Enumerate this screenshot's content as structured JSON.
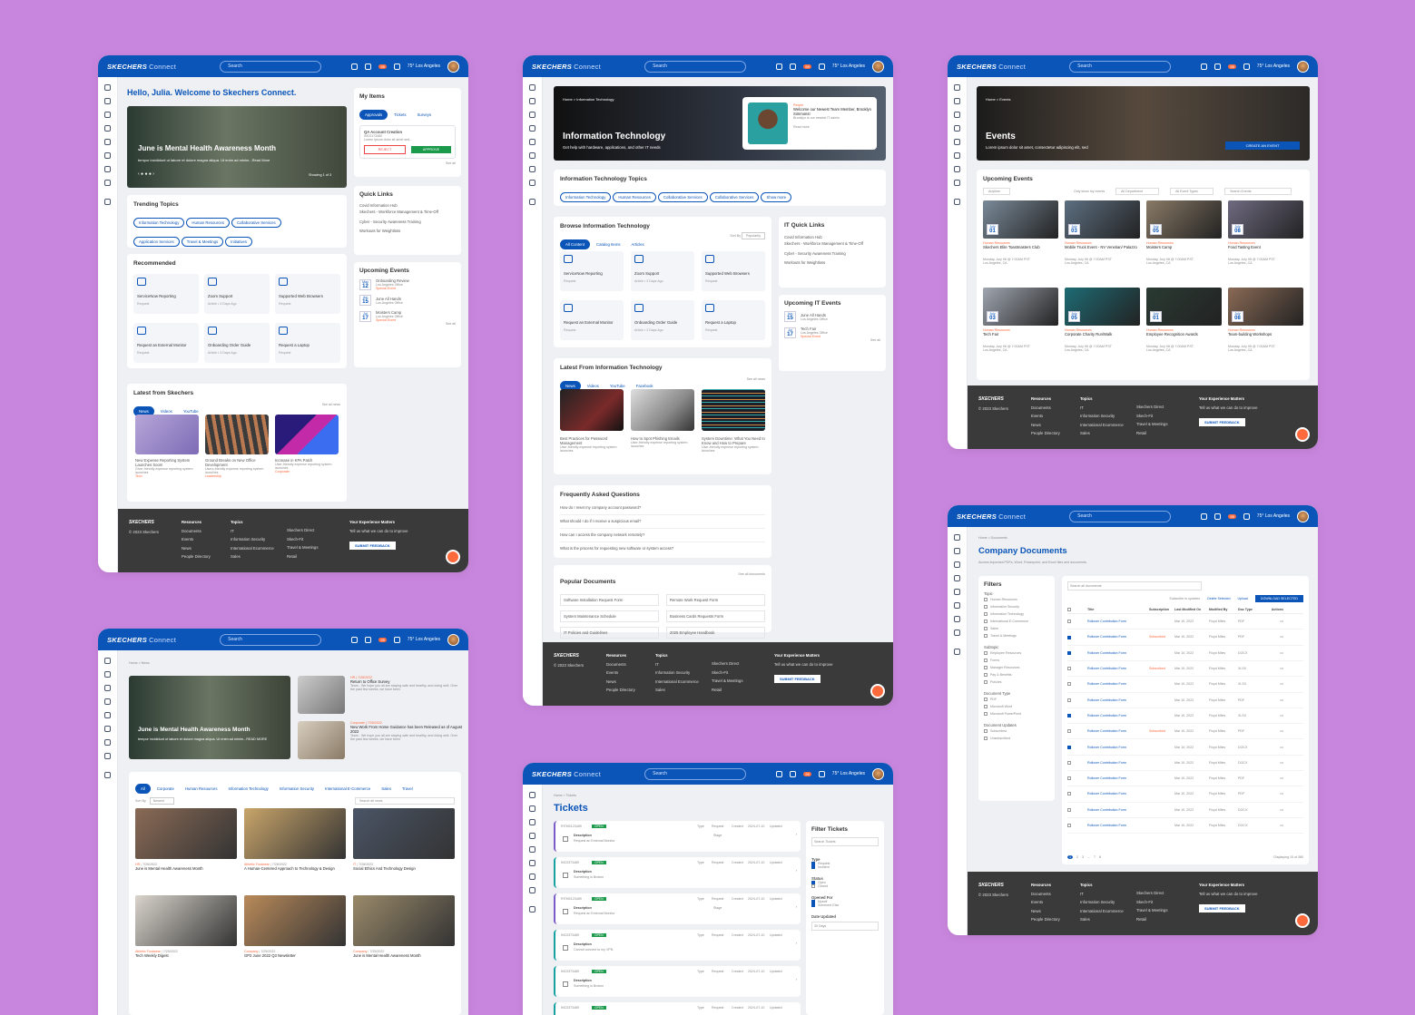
{
  "common": {
    "logo": "SKECHERS",
    "logo_sub": "Connect",
    "search": "Search",
    "weather": "75° Los Angeles",
    "badge": "99"
  },
  "home": {
    "greeting_a": "Hello, Julia.",
    "greeting_b": "Welcome to Skechers Connect.",
    "hero_title": "June is Mental Health Awareness Month",
    "hero_sub": "tempor incididunt ut labore et dolore magna aliqua. Ut enim ad minim...Read More",
    "hero_count": "Showing 1 of 3",
    "my_items": "My Items",
    "tabs": [
      "Approvals",
      "Tickets",
      "Surveys"
    ],
    "item_title": "QA Account Creation",
    "item_status": "NEW",
    "item_id": "INC0173480",
    "item_desc": "Lorem ipsum dolor sit amet sed...",
    "reject": "REJECT",
    "approve": "APPROVE",
    "see_all": "See all",
    "trending": "Trending Topics",
    "topics": [
      "Information Technology",
      "Human Resources",
      "Collaborative Services",
      "Application Services",
      "Travel & Meetings",
      "Initiatives"
    ],
    "quick_links": "Quick Links",
    "links": [
      "Covid Information Hub",
      "Skechers - Workforce Management & Time-Off",
      "Cyber - Security Awareness Training",
      "Workouts for Weightloss"
    ],
    "recommended": "Recommended",
    "rec": [
      {
        "t": "ServiceNow Reporting",
        "s": "Request"
      },
      {
        "t": "Zoom Support",
        "s": "Article • 3 Days Ago"
      },
      {
        "t": "Supported Web Browsers",
        "s": "Request"
      },
      {
        "t": "Request an External Monitor",
        "s": "Request"
      },
      {
        "t": "Onboarding Order Guide",
        "s": "Article • 3 Days Ago"
      },
      {
        "t": "Request a Laptop",
        "s": "Request"
      }
    ],
    "upcoming": "Upcoming Events",
    "events": [
      {
        "m": "May",
        "d": "12",
        "t": "Onboarding Review",
        "l": "Los Angeles Office",
        "x": "Special Event"
      },
      {
        "m": "Jun",
        "d": "15",
        "t": "June All Hands",
        "l": "Los Angeles Office",
        "x": ""
      },
      {
        "m": "Jul",
        "d": "17",
        "t": "Moisters Camp",
        "l": "Los Angeles Office",
        "x": "Special Event"
      }
    ],
    "latest": "Latest from Skechers",
    "latest_tabs": [
      "News",
      "Videos",
      "YouTube"
    ],
    "see_all_news": "See all news",
    "news": [
      {
        "t": "New Expense Reporting System Launches Soon!",
        "d": "Giver-friendly expense reporting system launches",
        "tag": "Tech"
      },
      {
        "t": "Ground Breaks on New Office Development",
        "d": "Users-friendly expense reporting system launches",
        "tag": "Leadership"
      },
      {
        "t": "Increase in KPA Patch",
        "d": "User-friendly expense reporting system launches",
        "tag": "Corporate"
      }
    ]
  },
  "footer": {
    "copy": "© 2023 Skechers",
    "resources": "Resources",
    "res": [
      "Documents",
      "Events",
      "News",
      "People Directory"
    ],
    "topics": "Topics",
    "top": [
      "IT",
      "Information Security",
      "International Ecommerce",
      "Sales"
    ],
    "more": [
      "Skechers Direct",
      "Skech-Fit",
      "Travel & Meetings",
      "Retail"
    ],
    "matters": "Your Experience Matters",
    "matters_sub": "Tell us what we can do to improve",
    "submit": "SUBMIT FEEDBACK"
  },
  "it": {
    "crumb": "Home  >  Information Technology",
    "title": "Information Technology",
    "sub": "Get help with hardware, applications, and other IT needs",
    "card_tag": "People",
    "card_title": "Welcome our Newest Team Member, Brooklyn Simmons!",
    "card_sub": "Brooklyn is our newest IT admin",
    "card_more": "Read more",
    "topics_h": "Information Technology Topics",
    "topics": [
      "Information Technology",
      "Human Resources",
      "Collaborative Services",
      "Collaborative Services",
      "Show more"
    ],
    "browse": "Browse Information Technology",
    "browse_tabs": [
      "All Content",
      "Catalog Items",
      "Articles"
    ],
    "sort": "Sort By",
    "sort_val": "Popularity",
    "quick": "IT Quick Links",
    "upcoming": "Upcoming IT Events",
    "ev": [
      {
        "m": "Jun",
        "d": "15",
        "t": "June All Hands",
        "l": "Los Angeles Office"
      },
      {
        "m": "Jul",
        "d": "17",
        "t": "Tech Fair",
        "l": "Los Angeles Office",
        "x": "Special Event"
      }
    ],
    "latest": "Latest From Information Technology",
    "latest_tabs": [
      "News",
      "Videos",
      "YouTube",
      "Facebook"
    ],
    "news": [
      {
        "t": "Best Practices for Password Management",
        "d": "User-friendly expense reporting system launches"
      },
      {
        "t": "How to Spot Phishing Emails",
        "d": "User-friendly expense reporting system launches"
      },
      {
        "t": "System Downtime: What You Need to Know and How to Prepare",
        "d": "User-friendly expense reporting system launches"
      }
    ],
    "faq": "Frequently Asked Questions",
    "faqs": [
      "How do I reset my company account password?",
      "What should I do if I receive a suspicious email?",
      "How can I access the company network remotely?",
      "What is the process for requesting new software or system access?"
    ],
    "docs": "Popular Documents",
    "see_docs": "See all documents",
    "doc_list": [
      "Software Installation Request Form",
      "Remote Work Request Form",
      "System Maintenance Schedule",
      "Business Cards Requests Form",
      "IT Policies and Guidelines",
      "2025 Employee Handbook"
    ]
  },
  "events": {
    "crumb": "Home  >  Events",
    "title": "Events",
    "sub": "Lorem ipsum dolor sit amet, consectetur adipiscing elit, sed",
    "create": "CREATE AN EVENT",
    "upcoming": "Upcoming Events",
    "filters": [
      "Anytime",
      "Only show my events",
      "All Department",
      "All Event Types",
      "Search Events"
    ],
    "cards": [
      {
        "d": "01",
        "t": "Skechers Elite Toastmasters Club",
        "tag": "Human Resources"
      },
      {
        "d": "03",
        "t": "Mobile Truck Event - NV Venetian/ Palazzo",
        "tag": "Human Resources"
      },
      {
        "d": "05",
        "t": "Moisters Camp",
        "tag": "Human Resources"
      },
      {
        "d": "08",
        "t": "Food Tasting Event",
        "tag": "Human Resources"
      },
      {
        "d": "03",
        "t": "Tech Fair",
        "tag": "Human Resources"
      },
      {
        "d": "05",
        "t": "Corporate Charity Run/Walk",
        "tag": "Human Resources"
      },
      {
        "d": "01",
        "t": "Employee Recognition Awards",
        "tag": "Human Resources"
      },
      {
        "d": "08",
        "t": "Team-building Workshops",
        "tag": "Human Resources"
      }
    ],
    "when": "Monday, July 08 @ 7:00AM PST",
    "where": "Los Angeles, CA",
    "month": "July"
  },
  "newspage": {
    "crumb": "Home  >  News",
    "hero_title": "June is Mental Health Awareness Month",
    "hero_sub": "tempor incididunt ut labore et dolore magna aliqua. Ut enim ad minim...READ MORE",
    "side": [
      {
        "tag": "HR",
        "date": "7/28/2022",
        "t": "Return to Office Survey",
        "d": "Team - We hope you all are staying safe and healthy, and doing well. Over the past few weeks, we have been"
      },
      {
        "tag": "Corporate",
        "date": "7/28/2022",
        "t": "New Work From Home Guidance has been Released as of August 2022",
        "d": "Team - We hope you all are staying safe and healthy, and doing well. Over the past few weeks, we have been"
      }
    ],
    "filters": [
      "All",
      "Corporate",
      "Human Resources",
      "Information Technology",
      "Information Security",
      "International E-Commerce",
      "Sales",
      "Travel"
    ],
    "sort": "Sort By",
    "sort_val": "Newest",
    "search": "Search all news",
    "grid": [
      {
        "tag": "HR",
        "date": "7/26/2022",
        "t": "June is Mental Health Awareness Month"
      },
      {
        "tag": "Athletic Footwear",
        "date": "7/28/2022",
        "t": "A Human-Centered Approach to Technology & Design"
      },
      {
        "tag": "IT",
        "date": "7/28/2022",
        "t": "Social Ethics And Technology Design"
      },
      {
        "tag": "Athletic Footwear",
        "date": "7/25/2022",
        "t": "Tech Weekly Digest"
      },
      {
        "tag": "Company",
        "date": "7/25/2022",
        "t": "GP2 June 2022 Q3 Newsletter"
      },
      {
        "tag": "Company",
        "date": "7/25/2022",
        "t": "June is Mental Health Awareness Month"
      }
    ]
  },
  "tickets": {
    "crumb": "Home  >  Tickets",
    "title": "Tickets",
    "rows": [
      {
        "id": "RITM0123489",
        "st": "OPEN",
        "desc": "Request an External Monitor",
        "stage": "Stage"
      },
      {
        "id": "INC0373489",
        "st": "OPEN",
        "desc": "Something is Broken",
        "stage": ""
      },
      {
        "id": "RITM0123489",
        "st": "OPEN",
        "desc": "Request an External Monitor",
        "stage": "Stage"
      },
      {
        "id": "INC0373489",
        "st": "OPEN",
        "desc": "Cannot connect to my VPN",
        "stage": ""
      },
      {
        "id": "INC0373489",
        "st": "OPEN",
        "desc": "Something is Broken",
        "stage": ""
      },
      {
        "id": "INC0373489",
        "st": "OPEN",
        "desc": "",
        "stage": ""
      }
    ],
    "type": "Type",
    "type_val": "Request",
    "created": "Created",
    "created_val": "2024-07-10",
    "updated": "Updated",
    "updated_val": "2024-07-10",
    "description": "Description",
    "filter": "Filter Tickets",
    "search": "Search Tickets",
    "f_type": "Type",
    "types": [
      "Request",
      "Incident"
    ],
    "f_status": "Status",
    "statuses": [
      "Open",
      "Closed"
    ],
    "f_opened": "Opened For",
    "opened": [
      "Myself",
      "Someone Else"
    ],
    "f_date": "Date Updated",
    "date_val": "30 Days"
  },
  "docs": {
    "crumb": "Home  >  Documents",
    "title": "Company Documents",
    "sub": "Access important PDFs, Word, Powerpoint, and Excel files and documents.",
    "filters": "Filters",
    "topic": "Topic",
    "topics": [
      "Human Resources",
      "Information Security",
      "Information Technology",
      "International E-Commerce",
      "Sales",
      "Travel & Meetings"
    ],
    "subtopic": "Subtopic",
    "subtopics": [
      "Employee Resources",
      "Forms",
      "Manager Resources",
      "Pay & Benefits",
      "Policies"
    ],
    "doctype": "Document Type",
    "doctypes": [
      "PDF",
      "Microsoft Word",
      "Microsoft PowerPoint"
    ],
    "docup": "Document Updates",
    "docups": [
      "Subscribed",
      "Unsubscribed"
    ],
    "search": "Search all documents",
    "sub_upd": "Subscribe to updates",
    "del": "Delete Selected",
    "upload": "Upload",
    "download": "DOWNLOAD SELECTED",
    "cols": [
      "Title",
      "Subscription",
      "Last Modified On",
      "Modified By",
      "Doc Type",
      "Actions"
    ],
    "row_title": "Rollover Contribution Form",
    "row_date": "Mar 10, 2022",
    "row_by": "Floyd Miles",
    "subscribed": "Subscribed",
    "types": [
      "PDF",
      "PDF",
      "DOCX",
      "XLSX",
      "XLSX",
      "PDF",
      "XLSX",
      "PDF",
      "DOCX",
      "DOCX",
      "PDF",
      "PDF",
      "DOCX",
      "DOCX"
    ],
    "pages": [
      "1",
      "2",
      "3",
      "...",
      "7",
      "8"
    ],
    "displaying": "Displaying 15 of 380"
  },
  "colors": {
    "primary": "#0b55b8",
    "accent": "#ff6a3d",
    "bg": "#c986de",
    "footer": "#3a3a3a"
  }
}
